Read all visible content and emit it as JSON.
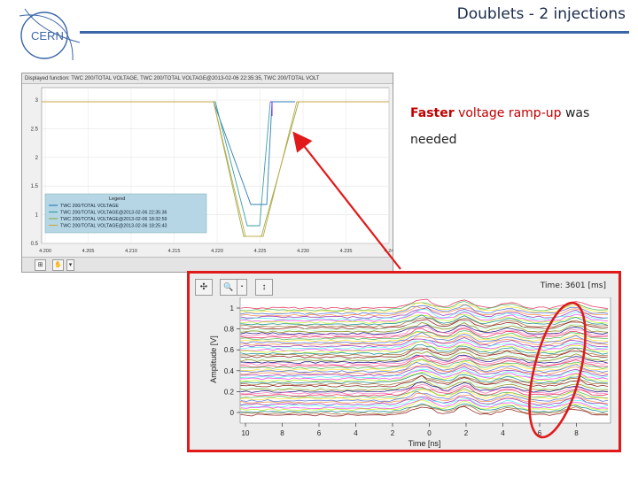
{
  "slide": {
    "title": "Doublets - 2 injections",
    "logo_text": "CERN",
    "note_part1": "Faster",
    "note_part2": "voltage ramp-up",
    "note_part3": " was needed"
  },
  "screen1": {
    "header": "Displayed function: TWC 200/TOTAL VOLTAGE, TWC 200/TOTAL VOLTAGE@2013-02-06 22:35:35, TWC 200/TOTAL VOLT",
    "yticks": [
      "3",
      "2.5",
      "2",
      "1.5",
      "1",
      "0.5"
    ],
    "xticks": [
      "4.200",
      "4.205",
      "4.210",
      "4.215",
      "4.220",
      "4.225",
      "4.230",
      "4.235",
      "4.24"
    ],
    "legend_title": "Legend",
    "legend_items": [
      {
        "label": "TWC 200/TOTAL VOLTAGE",
        "color": "#2f7fb3"
      },
      {
        "label": "TWC 200/TOTAL VOLTAGE@2013-02-06 22:35:36",
        "color": "#3aa0a0"
      },
      {
        "label": "TWC 200/TOTAL VOLTAGE@2013-02-06 18:32:59",
        "color": "#8fb050"
      },
      {
        "label": "TWC 200/TOTAL VOLTAGE@2013-02-06 18:25:43",
        "color": "#c8a84a"
      }
    ],
    "toolbar_buttons": [
      "⊞",
      "✋",
      "▾"
    ]
  },
  "screen2": {
    "time_label": "Time: 3601 [ms]",
    "buttons": [
      "✣",
      "🔍",
      "▪",
      "↕"
    ],
    "ylabel": "Amplitude [V]",
    "yticks": [
      "1",
      "0.8",
      "0.6",
      "0.4",
      "0.2",
      "0"
    ],
    "xticks": [
      "10",
      "8",
      "6",
      "4",
      "2",
      "0",
      "2",
      "4",
      "6",
      "8"
    ],
    "xlabel": "Time [ns]"
  },
  "colors": {
    "accent_red": "#e01a1a",
    "title_rule": "#3a66a8"
  }
}
